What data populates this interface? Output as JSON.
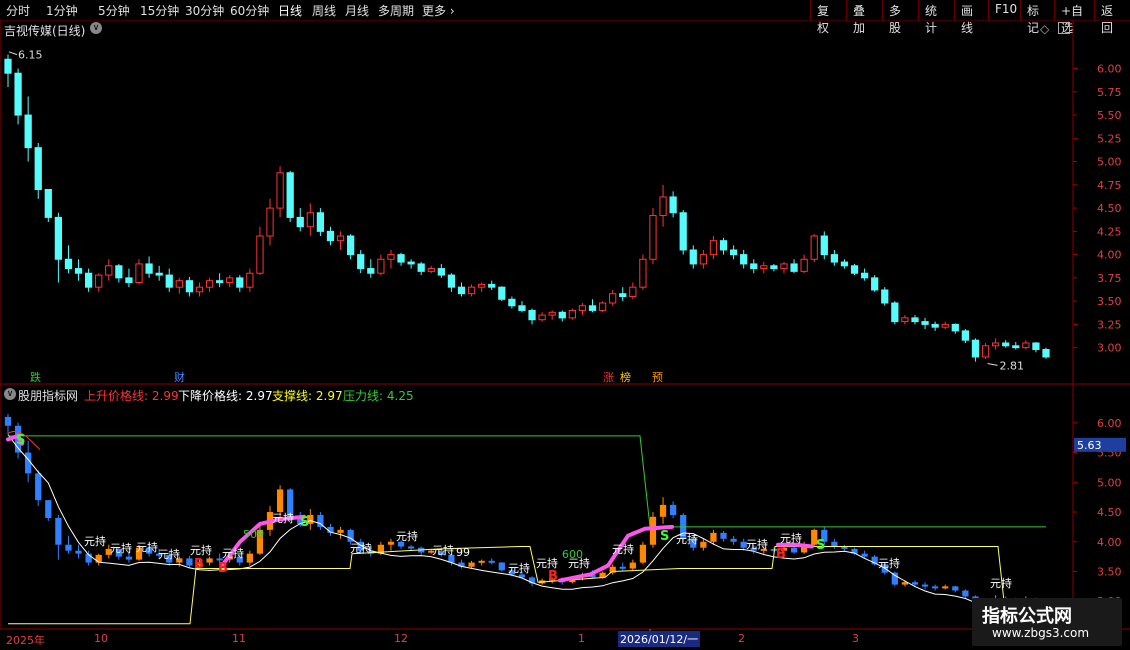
{
  "toolbar": {
    "periods": [
      "分时",
      "1分钟",
      "5分钟",
      "15分钟",
      "30分钟",
      "60分钟",
      "日线",
      "周线",
      "月线",
      "多周期",
      "更多"
    ],
    "active_period": "日线",
    "right_buttons": [
      "复权",
      "叠加",
      "多股",
      "统计",
      "画线",
      "F10",
      "标记",
      "+自选",
      "返回"
    ]
  },
  "main_chart": {
    "title": "吉视传媒(日线)",
    "high_label": "6.15",
    "low_label": "2.81",
    "markers": [
      {
        "text": "跌",
        "color": "#33cc33"
      },
      {
        "text": "财",
        "color": "#4488ff"
      },
      {
        "text": "涨",
        "color": "#ff3333"
      },
      {
        "text": "榜",
        "color": "#ffcc00"
      },
      {
        "text": "预",
        "color": "#ff9900"
      }
    ],
    "y_ticks": [
      "6.00",
      "5.75",
      "5.50",
      "5.25",
      "5.00",
      "4.75",
      "4.50",
      "4.25",
      "4.00",
      "3.75",
      "3.50",
      "3.25",
      "3.00"
    ],
    "y_range": [
      2.62,
      6.35
    ]
  },
  "indicator": {
    "name": "股朋指标网",
    "fields": [
      {
        "label": "上升价格线:",
        "value": "2.99",
        "color": "#ff3333"
      },
      {
        "label": "下降价格线:",
        "value": "2.97",
        "color": "#ffffff"
      },
      {
        "label": "支撑线:",
        "value": "2.97",
        "color": "#ffff00"
      },
      {
        "label": "压力线:",
        "value": "4.25",
        "color": "#33cc33"
      }
    ],
    "y_ticks": [
      "6.00",
      "5.50",
      "5.00",
      "4.50",
      "4.00",
      "3.50",
      "3.00"
    ],
    "current_value": "5.63",
    "y_range": [
      2.55,
      6.35
    ],
    "annotations": {
      "hold": "元持",
      "buy": "B",
      "sell": "S",
      "num1": "509",
      "num2": "99",
      "num3": "600"
    }
  },
  "date_axis": {
    "labels": [
      "2025年",
      "10",
      "11",
      "12",
      "1",
      "2026/01/12/一",
      "2",
      "3"
    ]
  },
  "watermark": {
    "main": "指标公式网",
    "sub": "www.zbgs3.com"
  },
  "chart_data": {
    "type": "candlestick",
    "title": "吉视传媒(日线)",
    "ylim": [
      2.62,
      6.35
    ],
    "candles": [
      [
        6.1,
        6.15,
        5.8,
        5.95
      ],
      [
        5.95,
        6.0,
        5.4,
        5.5
      ],
      [
        5.5,
        5.7,
        5.0,
        5.15
      ],
      [
        5.15,
        5.2,
        4.6,
        4.7
      ],
      [
        4.7,
        4.6,
        4.35,
        4.4
      ],
      [
        4.4,
        4.45,
        3.7,
        3.95
      ],
      [
        3.95,
        4.1,
        3.8,
        3.85
      ],
      [
        3.85,
        3.95,
        3.72,
        3.8
      ],
      [
        3.8,
        3.85,
        3.6,
        3.65
      ],
      [
        3.65,
        3.8,
        3.6,
        3.78
      ],
      [
        3.78,
        3.95,
        3.72,
        3.88
      ],
      [
        3.88,
        3.9,
        3.7,
        3.75
      ],
      [
        3.75,
        3.85,
        3.65,
        3.7
      ],
      [
        3.7,
        3.95,
        3.68,
        3.9
      ],
      [
        3.9,
        3.98,
        3.75,
        3.8
      ],
      [
        3.8,
        3.88,
        3.72,
        3.78
      ],
      [
        3.78,
        3.85,
        3.6,
        3.65
      ],
      [
        3.65,
        3.75,
        3.58,
        3.72
      ],
      [
        3.72,
        3.76,
        3.55,
        3.6
      ],
      [
        3.6,
        3.7,
        3.55,
        3.65
      ],
      [
        3.65,
        3.75,
        3.6,
        3.72
      ],
      [
        3.72,
        3.8,
        3.65,
        3.7
      ],
      [
        3.7,
        3.78,
        3.65,
        3.75
      ],
      [
        3.75,
        3.78,
        3.6,
        3.65
      ],
      [
        3.65,
        3.85,
        3.6,
        3.8
      ],
      [
        3.8,
        4.3,
        3.78,
        4.2
      ],
      [
        4.2,
        4.6,
        4.1,
        4.5
      ],
      [
        4.5,
        4.95,
        4.4,
        4.88
      ],
      [
        4.88,
        4.9,
        4.35,
        4.4
      ],
      [
        4.4,
        4.5,
        4.25,
        4.3
      ],
      [
        4.3,
        4.55,
        4.2,
        4.45
      ],
      [
        4.45,
        4.5,
        4.2,
        4.25
      ],
      [
        4.25,
        4.3,
        4.1,
        4.15
      ],
      [
        4.15,
        4.25,
        4.05,
        4.2
      ],
      [
        4.2,
        4.22,
        3.95,
        4.0
      ],
      [
        4.0,
        4.05,
        3.8,
        3.85
      ],
      [
        3.85,
        3.95,
        3.75,
        3.8
      ],
      [
        3.8,
        4.0,
        3.78,
        3.95
      ],
      [
        3.95,
        4.05,
        3.85,
        4.0
      ],
      [
        4.0,
        4.02,
        3.88,
        3.92
      ],
      [
        3.92,
        3.95,
        3.85,
        3.9
      ],
      [
        3.9,
        3.92,
        3.78,
        3.82
      ],
      [
        3.82,
        3.88,
        3.8,
        3.85
      ],
      [
        3.85,
        3.9,
        3.75,
        3.78
      ],
      [
        3.78,
        3.8,
        3.6,
        3.65
      ],
      [
        3.65,
        3.7,
        3.55,
        3.58
      ],
      [
        3.58,
        3.68,
        3.55,
        3.65
      ],
      [
        3.65,
        3.7,
        3.6,
        3.68
      ],
      [
        3.68,
        3.72,
        3.62,
        3.65
      ],
      [
        3.65,
        3.66,
        3.5,
        3.52
      ],
      [
        3.52,
        3.55,
        3.42,
        3.45
      ],
      [
        3.45,
        3.5,
        3.38,
        3.4
      ],
      [
        3.4,
        3.42,
        3.25,
        3.3
      ],
      [
        3.3,
        3.38,
        3.28,
        3.35
      ],
      [
        3.35,
        3.4,
        3.3,
        3.38
      ],
      [
        3.38,
        3.4,
        3.28,
        3.32
      ],
      [
        3.32,
        3.42,
        3.3,
        3.4
      ],
      [
        3.4,
        3.48,
        3.35,
        3.45
      ],
      [
        3.45,
        3.52,
        3.38,
        3.4
      ],
      [
        3.4,
        3.5,
        3.38,
        3.48
      ],
      [
        3.48,
        3.62,
        3.45,
        3.58
      ],
      [
        3.58,
        3.65,
        3.5,
        3.55
      ],
      [
        3.55,
        3.7,
        3.52,
        3.65
      ],
      [
        3.65,
        4.0,
        3.62,
        3.95
      ],
      [
        3.95,
        4.5,
        3.9,
        4.42
      ],
      [
        4.42,
        4.75,
        4.3,
        4.62
      ],
      [
        4.62,
        4.68,
        4.4,
        4.45
      ],
      [
        4.45,
        4.48,
        4.0,
        4.05
      ],
      [
        4.05,
        4.1,
        3.85,
        3.9
      ],
      [
        3.9,
        4.05,
        3.85,
        4.0
      ],
      [
        4.0,
        4.2,
        3.95,
        4.15
      ],
      [
        4.15,
        4.18,
        4.0,
        4.05
      ],
      [
        4.05,
        4.1,
        3.95,
        4.0
      ],
      [
        4.0,
        4.05,
        3.85,
        3.9
      ],
      [
        3.9,
        3.95,
        3.8,
        3.85
      ],
      [
        3.85,
        3.92,
        3.8,
        3.88
      ],
      [
        3.88,
        3.9,
        3.82,
        3.85
      ],
      [
        3.85,
        3.92,
        3.8,
        3.9
      ],
      [
        3.9,
        3.95,
        3.8,
        3.82
      ],
      [
        3.82,
        4.0,
        3.8,
        3.95
      ],
      [
        3.95,
        4.22,
        3.92,
        4.2
      ],
      [
        4.2,
        4.25,
        3.95,
        4.0
      ],
      [
        4.0,
        4.05,
        3.88,
        3.92
      ],
      [
        3.92,
        3.95,
        3.85,
        3.88
      ],
      [
        3.88,
        3.9,
        3.78,
        3.8
      ],
      [
        3.8,
        3.85,
        3.72,
        3.75
      ],
      [
        3.75,
        3.78,
        3.6,
        3.62
      ],
      [
        3.62,
        3.65,
        3.45,
        3.48
      ],
      [
        3.48,
        3.5,
        3.25,
        3.28
      ],
      [
        3.28,
        3.35,
        3.25,
        3.32
      ],
      [
        3.32,
        3.35,
        3.25,
        3.28
      ],
      [
        3.28,
        3.32,
        3.2,
        3.25
      ],
      [
        3.25,
        3.28,
        3.18,
        3.22
      ],
      [
        3.22,
        3.28,
        3.2,
        3.25
      ],
      [
        3.25,
        3.26,
        3.15,
        3.18
      ],
      [
        3.18,
        3.2,
        3.05,
        3.08
      ],
      [
        3.08,
        3.1,
        2.85,
        2.9
      ],
      [
        2.9,
        3.05,
        2.88,
        3.02
      ],
      [
        3.02,
        3.1,
        2.98,
        3.05
      ],
      [
        3.05,
        3.08,
        3.0,
        3.02
      ],
      [
        3.02,
        3.06,
        2.98,
        3.0
      ],
      [
        3.0,
        3.08,
        2.98,
        3.05
      ],
      [
        3.05,
        3.06,
        2.95,
        2.98
      ],
      [
        2.98,
        3.0,
        2.88,
        2.9
      ]
    ]
  }
}
